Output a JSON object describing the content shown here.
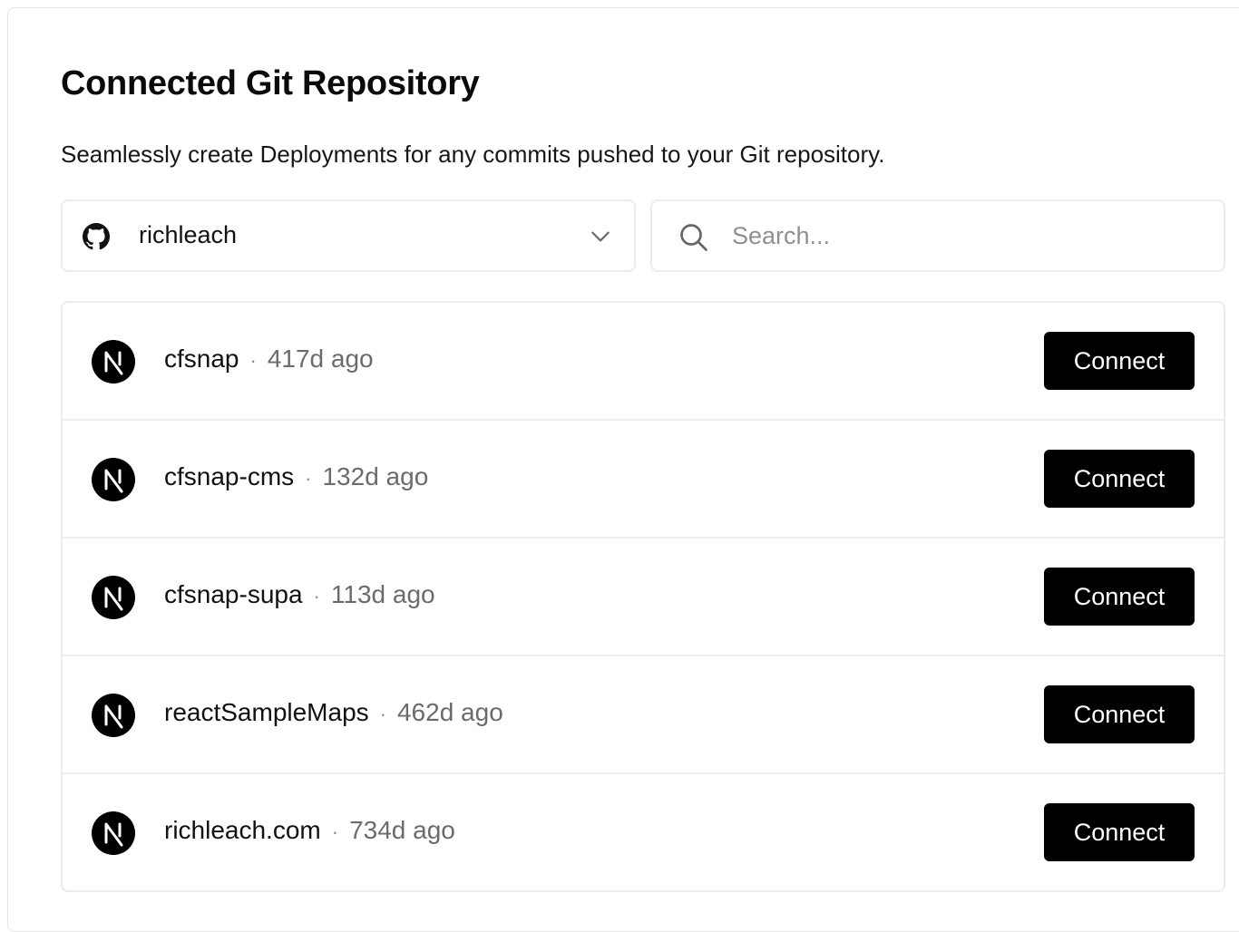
{
  "header": {
    "title": "Connected Git Repository",
    "subtitle": "Seamlessly create Deployments for any commits pushed to your Git repository."
  },
  "account_select": {
    "provider_icon": "github-icon",
    "value": "richleach",
    "chevron_icon": "chevron-down-icon"
  },
  "search": {
    "icon": "search-icon",
    "placeholder": "Search...",
    "value": ""
  },
  "repos": [
    {
      "name": "cfsnap",
      "separator": "·",
      "age": "417d ago",
      "action": "Connect",
      "icon": "nextjs-icon"
    },
    {
      "name": "cfsnap-cms",
      "separator": "·",
      "age": "132d ago",
      "action": "Connect",
      "icon": "nextjs-icon"
    },
    {
      "name": "cfsnap-supa",
      "separator": "·",
      "age": "113d ago",
      "action": "Connect",
      "icon": "nextjs-icon"
    },
    {
      "name": "reactSampleMaps",
      "separator": "·",
      "age": "462d ago",
      "action": "Connect",
      "icon": "nextjs-icon"
    },
    {
      "name": "richleach.com",
      "separator": "·",
      "age": "734d ago",
      "action": "Connect",
      "icon": "nextjs-icon"
    }
  ],
  "colors": {
    "button_bg": "#000000",
    "button_text": "#ffffff",
    "border": "#ececec",
    "muted_text": "#6b6b6b"
  }
}
